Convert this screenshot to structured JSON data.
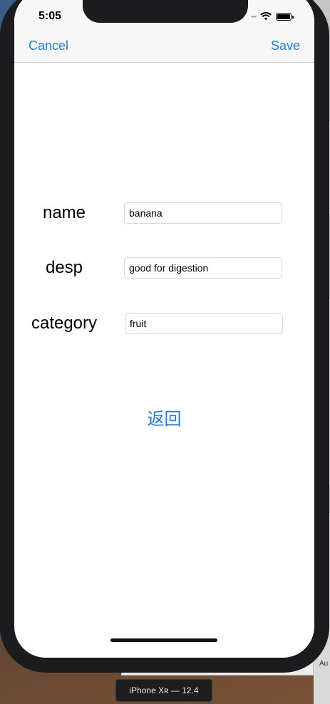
{
  "status_bar": {
    "time": "5:05",
    "signal_icon": "signal-dots-icon",
    "wifi_icon": "wifi-icon",
    "battery_icon": "battery-icon"
  },
  "nav_bar": {
    "cancel_label": "Cancel",
    "save_label": "Save"
  },
  "form": {
    "fields": [
      {
        "label": "name",
        "value": "banana"
      },
      {
        "label": "desp",
        "value": "good for digestion"
      },
      {
        "label": "category",
        "value": "fruit"
      }
    ]
  },
  "back_button_label": "返回",
  "simulator": {
    "device_label": "iPhone Xʀ — 12.4"
  },
  "desktop": {
    "edge_text": "Au"
  },
  "colors": {
    "accent": "#1a7ef2",
    "device_frame": "#1c1c1e",
    "nav_background": "#f7f7f7"
  }
}
